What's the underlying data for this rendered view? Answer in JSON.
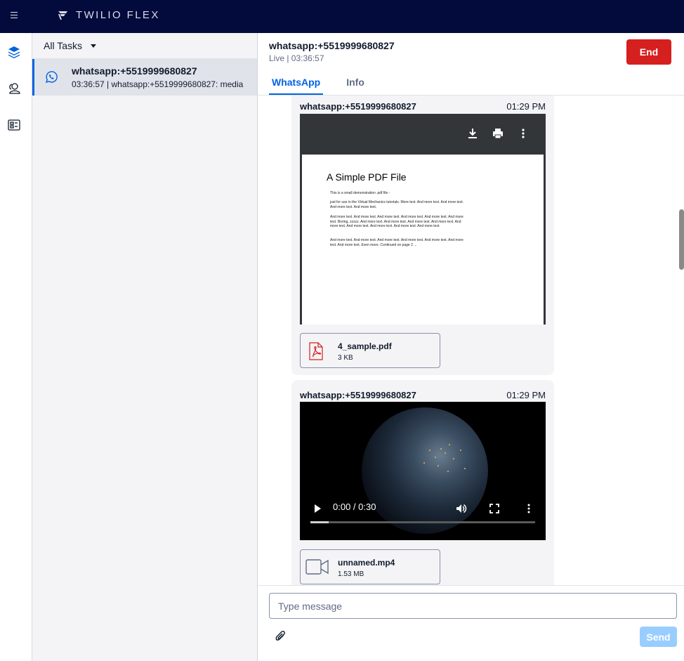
{
  "topbar": {
    "brand": "TWILIO FLEX"
  },
  "rail": {
    "items": [
      {
        "icon": "layers-icon",
        "active": true
      },
      {
        "icon": "agents-icon",
        "active": false
      },
      {
        "icon": "queue-card-icon",
        "active": false
      }
    ]
  },
  "tasklist": {
    "filter_label": "All Tasks",
    "tasks": [
      {
        "title": "whatsapp:+5519999680827",
        "subtitle": "03:36:57 | whatsapp:+5519999680827: media"
      }
    ]
  },
  "conversation": {
    "title": "whatsapp:+5519999680827",
    "status": "Live | 03:36:57",
    "end_label": "End",
    "tabs": [
      {
        "label": "WhatsApp",
        "active": true
      },
      {
        "label": "Info",
        "active": false
      }
    ]
  },
  "messages": [
    {
      "sender": "whatsapp:+5519999680827",
      "time": "01:29 PM",
      "pdf_preview": {
        "heading": "A Simple PDF File",
        "paragraphs": [
          "This is a small demonstration .pdf file -",
          "just for use in the Virtual Mechanics tutorials. More text. And more text. And more text. And more text. And more text.",
          "And more text. And more text. And more text. And more text. And more text. And more text. Boring, zzzzz. And more text. And more text. And more text. And more text. And more text. And more text. And more text. And more text. And more text.",
          "And more text. And more text. And more text. And more text. And more text. And more text. And more text. Even more. Continued on page 2 ..."
        ]
      },
      "attachment": {
        "name": "4_sample.pdf",
        "size": "3 KB",
        "icon": "pdf-file-icon"
      }
    },
    {
      "sender": "whatsapp:+5519999680827",
      "time": "01:29 PM",
      "video": {
        "time": "0:00 / 0:30",
        "progress": 0.08
      },
      "attachment": {
        "name": "unnamed.mp4",
        "size": "1.53 MB",
        "icon": "video-file-icon"
      }
    }
  ],
  "composer": {
    "placeholder": "Type message",
    "send_label": "Send"
  },
  "colors": {
    "topbar": "#030b3d",
    "accent": "#0263e0",
    "end": "#d61f1f",
    "send_disabled": "#99cdff"
  }
}
